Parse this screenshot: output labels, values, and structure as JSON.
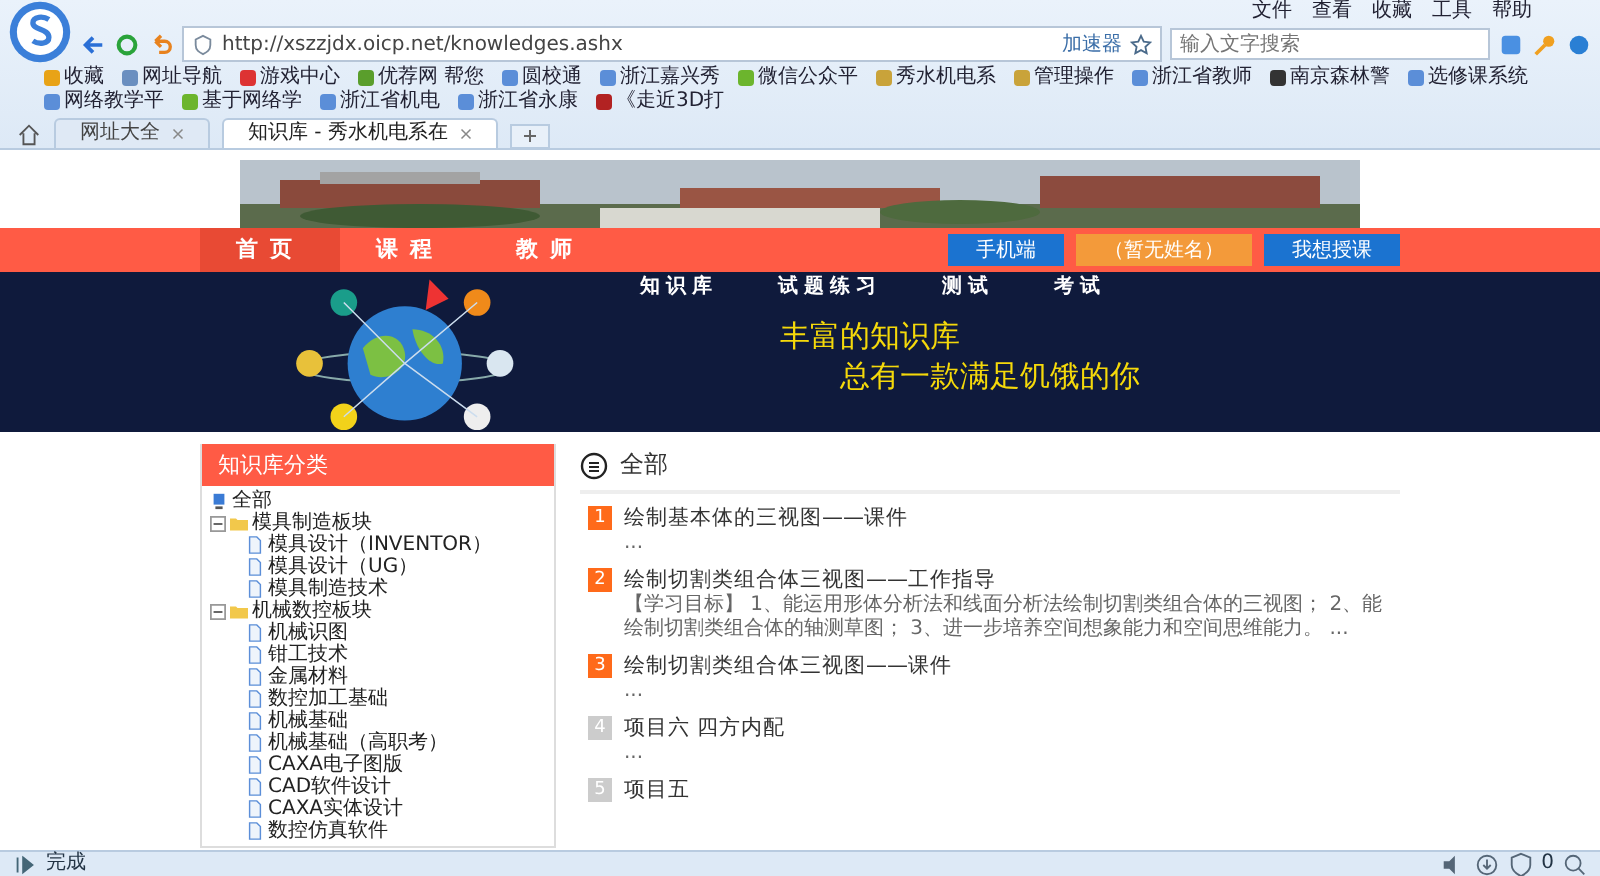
{
  "browser": {
    "menu": [
      "文件",
      "查看",
      "收藏",
      "工具",
      "帮助"
    ],
    "url": "http://xszzjdx.oicp.net/knowledges.ashx",
    "accelerator": "加速器",
    "search": {
      "placeholder": "输入文字搜索"
    },
    "bookmarks": [
      {
        "label": "收藏",
        "kind": "star"
      },
      {
        "label": "网址导航",
        "kind": "globe"
      },
      {
        "label": "游戏中心",
        "kind": "game"
      },
      {
        "label": "优荐网 帮您",
        "kind": "leaf"
      },
      {
        "label": "圆校通",
        "kind": "page"
      },
      {
        "label": "浙江嘉兴秀",
        "kind": "page"
      },
      {
        "label": "微信公众平",
        "kind": "chat"
      },
      {
        "label": "秀水机电系",
        "kind": "site"
      },
      {
        "label": "管理操作",
        "kind": "site"
      },
      {
        "label": "浙江省教师",
        "kind": "page"
      },
      {
        "label": "南京森林警",
        "kind": "badge"
      },
      {
        "label": "选修课系统",
        "kind": "page"
      },
      {
        "label": "网络教学平",
        "kind": "page"
      },
      {
        "label": "基于网络学",
        "kind": "chat"
      },
      {
        "label": "浙江省机电",
        "kind": "page"
      },
      {
        "label": "浙江省永康",
        "kind": "page"
      },
      {
        "label": "《走近3D打",
        "kind": "book"
      }
    ],
    "tabs": [
      {
        "label": "网址大全",
        "selected": false
      },
      {
        "label": "知识库 - 秀水机电系在",
        "selected": true
      }
    ]
  },
  "page": {
    "nav": [
      {
        "label": "首页",
        "selected": true
      },
      {
        "label": "课程",
        "selected": false
      },
      {
        "label": "教师",
        "selected": false
      }
    ],
    "actions": [
      {
        "label": "手机端",
        "color": "#1b73d0"
      },
      {
        "label": "（暂无姓名）",
        "color": "#f39a3a"
      },
      {
        "label": "我想授课",
        "color": "#1b73d0"
      }
    ],
    "subnav": [
      "知识库",
      "试题练习",
      "测试",
      "考试"
    ],
    "slogan": [
      "丰富的知识库",
      "总有一款满足饥饿的你"
    ]
  },
  "sidebar": {
    "title": "知识库分类",
    "tree": [
      {
        "label": "全部",
        "kind": "root"
      },
      {
        "label": "模具制造板块",
        "kind": "folder",
        "expanded": true,
        "children": [
          {
            "label": "模具设计（INVENTOR）",
            "kind": "doc"
          },
          {
            "label": "模具设计（UG）",
            "kind": "doc"
          },
          {
            "label": "模具制造技术",
            "kind": "doc"
          }
        ]
      },
      {
        "label": "机械数控板块",
        "kind": "folder",
        "expanded": true,
        "children": [
          {
            "label": "机械识图",
            "kind": "doc"
          },
          {
            "label": "钳工技术",
            "kind": "doc"
          },
          {
            "label": "金属材料",
            "kind": "doc"
          },
          {
            "label": "数控加工基础",
            "kind": "doc"
          },
          {
            "label": "机械基础",
            "kind": "doc"
          },
          {
            "label": "机械基础（高职考）",
            "kind": "doc"
          },
          {
            "label": "CAXA电子图版",
            "kind": "doc"
          },
          {
            "label": "CAD软件设计",
            "kind": "doc"
          },
          {
            "label": "CAXA实体设计",
            "kind": "doc"
          },
          {
            "label": "数控仿真软件",
            "kind": "doc"
          }
        ]
      }
    ]
  },
  "main": {
    "title": "全部",
    "items": [
      {
        "number": "1",
        "title": "绘制基本体的三视图——课件",
        "summary": "...",
        "highlighted": true
      },
      {
        "number": "2",
        "title": "绘制切割类组合体三视图——工作指导",
        "summary": "【学习目标】 1、能运用形体分析法和线面分析法绘制切割类组合体的三视图； 2、能绘制切割类组合体的轴测草图； 3、进一步培养空间想象能力和空间思维能力。 ...",
        "highlighted": true
      },
      {
        "number": "3",
        "title": "绘制切割类组合体三视图——课件",
        "summary": "...",
        "highlighted": true
      },
      {
        "number": "4",
        "title": "项目六 四方内配",
        "summary": "...",
        "highlighted": false
      },
      {
        "number": "5",
        "title": "项目五",
        "highlighted": false
      }
    ]
  },
  "status_bar": {
    "text": "完成",
    "counter": "0"
  }
}
